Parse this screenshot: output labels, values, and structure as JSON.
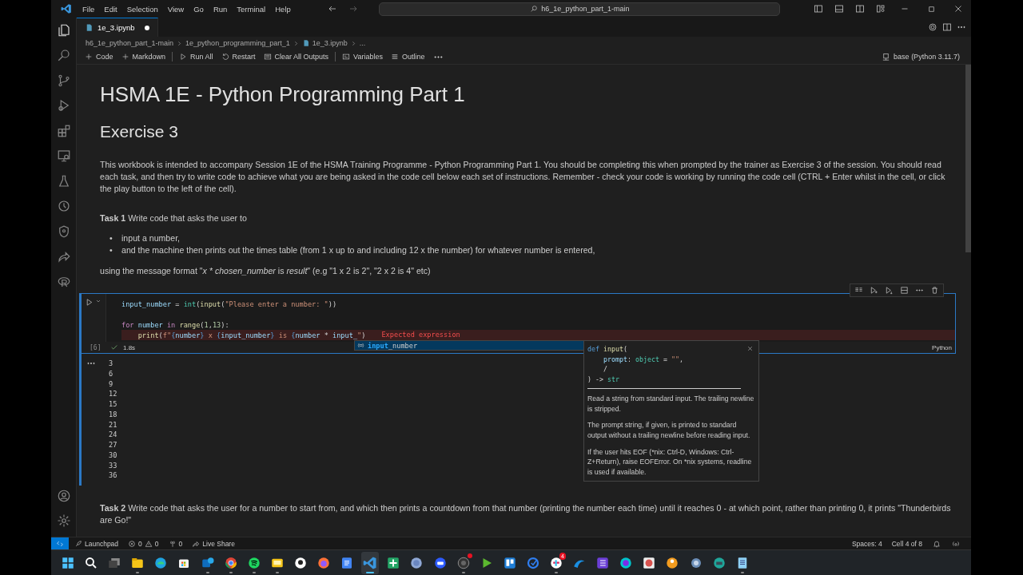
{
  "titlebar": {
    "menu": [
      "File",
      "Edit",
      "Selection",
      "View",
      "Go",
      "Run",
      "Terminal",
      "Help"
    ],
    "search": "h6_1e_python_part_1-main"
  },
  "tabs": [
    {
      "label": "1e_3.ipynb",
      "selected": true,
      "modified": true
    }
  ],
  "breadcrumbs": [
    "h6_1e_python_part_1-main",
    "1e_python_programming_part_1",
    "1e_3.ipynb",
    "..."
  ],
  "toolbar": {
    "actions": [
      {
        "kind": "plus",
        "label": "Code"
      },
      {
        "kind": "plus",
        "label": "Markdown"
      },
      {
        "kind": "run",
        "label": "Run All"
      },
      {
        "kind": "restart",
        "label": "Restart"
      },
      {
        "kind": "clear",
        "label": "Clear All Outputs"
      },
      {
        "kind": "variables",
        "label": "Variables"
      },
      {
        "kind": "outline",
        "label": "Outline"
      },
      {
        "kind": "more"
      }
    ],
    "kernel": "base (Python 3.11.7)"
  },
  "notebook": {
    "title": "HSMA 1E - Python Programming Part 1",
    "subtitle": "Exercise 3",
    "intro": "This workbook is intended to accompany Session 1E of the HSMA Training Programme - Python Programming Part 1. You should be completing this when prompted by the trainer as Exercise 3 of the session. You should read each task, and then try to write code to achieve what you are being asked in the code cell below each set of instructions. Remember - check your code is working by running the code cell (CTRL + Enter whilst in the cell, or click the play button to the left of the cell).",
    "task1": "**Task 1** Write code that asks the user to",
    "bullets": [
      {
        "marker": "•",
        "text": "input a number,"
      },
      {
        "marker": "•",
        "text": "and the machine then prints out the times table (from 1 x up to and including 12 x the number) for whatever number is entered,"
      }
    ],
    "format": [
      {
        "kind": "plain",
        "text": "using the message format \""
      },
      {
        "kind": "emphasis",
        "text": "x * chosen_number"
      },
      {
        "kind": "plain",
        "text": " is "
      },
      {
        "kind": "emphasis",
        "text": "result"
      },
      {
        "kind": "plain",
        "text": "\" (e.g \"1 x 2 is 2\", \"2 x 2 is 4\" etc)"
      }
    ],
    "cell": {
      "focused": true,
      "lines": [
        {
          "error": false,
          "tokens": [
            {
              "kind": "var",
              "text": "input_number"
            },
            {
              "kind": "op",
              "text": " = "
            },
            {
              "kind": "cls",
              "text": "int"
            },
            {
              "kind": "op",
              "text": "("
            },
            {
              "kind": "fn",
              "text": "input"
            },
            {
              "kind": "op",
              "text": "("
            },
            {
              "kind": "str",
              "text": "\"Please enter a number: \""
            },
            {
              "kind": "op",
              "text": "))"
            }
          ]
        },
        {
          "error": false,
          "gap_before": true,
          "tokens": [
            {
              "kind": "kw",
              "text": "for"
            },
            {
              "kind": "var",
              "text": " number"
            },
            {
              "kind": "kw",
              "text": " in"
            },
            {
              "kind": "fn",
              "text": " range"
            },
            {
              "kind": "op",
              "text": "("
            },
            {
              "kind": "num",
              "text": "1"
            },
            {
              "kind": "op",
              "text": ","
            },
            {
              "kind": "num",
              "text": "13"
            },
            {
              "kind": "op",
              "text": "):"
            }
          ]
        },
        {
          "error": true,
          "message": "Expected expression",
          "tokens": [
            {
              "kind": "fn",
              "text": "    print"
            },
            {
              "kind": "op",
              "text": "("
            },
            {
              "kind": "str",
              "text": "f\""
            },
            {
              "kind": "def",
              "text": "{"
            },
            {
              "kind": "var",
              "text": "number"
            },
            {
              "kind": "def",
              "text": "}"
            },
            {
              "kind": "str",
              "text": " x "
            },
            {
              "kind": "def",
              "text": "{"
            },
            {
              "kind": "var",
              "text": "input_number"
            },
            {
              "kind": "def",
              "text": "}"
            },
            {
              "kind": "str",
              "text": " is "
            },
            {
              "kind": "def",
              "text": "{"
            },
            {
              "kind": "var",
              "text": "number"
            },
            {
              "kind": "op",
              "text": " * "
            },
            {
              "kind": "var",
              "text": "input_"
            },
            {
              "kind": "str",
              "text": "\""
            },
            {
              "kind": "op",
              "text": ")"
            }
          ]
        }
      ],
      "execution_count": "[6]",
      "success": true,
      "duration": "1.8s",
      "language": "Python",
      "output": [
        "3",
        "6",
        "9",
        "12",
        "15",
        "18",
        "21",
        "24",
        "27",
        "30",
        "33",
        "36"
      ],
      "suggestion": {
        "match": "input",
        "rest": "_number",
        "selected": true
      },
      "hover": {
        "signature": [
          [
            {
              "kind": "def",
              "text": "def"
            },
            {
              "kind": "fn",
              "text": " input"
            },
            {
              "kind": "op",
              "text": "("
            }
          ],
          [
            {
              "kind": "param",
              "text": "    prompt"
            },
            {
              "kind": "op",
              "text": ": "
            },
            {
              "kind": "cls",
              "text": "object"
            },
            {
              "kind": "op",
              "text": " = "
            },
            {
              "kind": "str",
              "text": "\"\""
            },
            {
              "kind": "op",
              "text": ","
            }
          ],
          [
            {
              "kind": "op",
              "text": "    /"
            }
          ],
          [
            {
              "kind": "op",
              "text": ") -> "
            },
            {
              "kind": "cls",
              "text": "str"
            }
          ]
        ],
        "paragraphs": [
          "Read a string from standard input. The trailing newline is stripped.",
          "The prompt string, if given, is printed to standard output without a trailing newline before reading input.",
          "If the user hits EOF (*nix: Ctrl-D, Windows: Ctrl-Z+Return), raise EOFError. On *nix systems, readline is used if available."
        ]
      }
    },
    "task2": "**Task 2** Write code that asks the user for a number to start from, and which then prints a countdown from that number (printing the number each time) until it reaches 0 - at which point, rather than printing 0, it prints \"Thunderbirds are Go!\""
  },
  "status_bar": {
    "left": [
      {
        "kind": "launchpad",
        "label": "Launchpad"
      },
      {
        "kind": "problems",
        "errors": "0",
        "warnings": "0"
      },
      {
        "kind": "ports",
        "label": "0"
      },
      {
        "kind": "liveshare",
        "label": "Live Share"
      }
    ],
    "right": [
      {
        "kind": "text",
        "label": "Spaces: 4"
      },
      {
        "kind": "text",
        "label": "Cell 4 of 8"
      },
      {
        "kind": "bell"
      },
      {
        "kind": "copilot"
      }
    ]
  },
  "taskbar": {
    "apps": [
      {
        "running": false,
        "active": false
      },
      {
        "running": false,
        "active": false
      },
      {
        "running": false,
        "active": false
      },
      {
        "running": true,
        "active": false
      },
      {
        "running": false,
        "active": false
      },
      {
        "running": false,
        "active": false
      },
      {
        "running": true,
        "active": false
      },
      {
        "running": true,
        "active": false
      },
      {
        "running": true,
        "active": false
      },
      {
        "running": true,
        "active": false
      },
      {
        "running": false,
        "active": false
      },
      {
        "running": false,
        "active": false
      },
      {
        "running": false,
        "active": false
      },
      {
        "running": true,
        "active": true
      },
      {
        "running": false,
        "active": false
      },
      {
        "running": false,
        "active": false
      },
      {
        "running": false,
        "active": false
      },
      {
        "running": true,
        "active": false,
        "dot": true
      },
      {
        "running": false,
        "active": false
      },
      {
        "running": false,
        "active": false
      },
      {
        "running": false,
        "active": false
      },
      {
        "running": true,
        "active": false,
        "badge": "4"
      },
      {
        "running": false,
        "active": false
      },
      {
        "running": false,
        "active": false
      },
      {
        "running": false,
        "active": false
      },
      {
        "running": false,
        "active": false
      },
      {
        "running": false,
        "active": false
      },
      {
        "running": false,
        "active": false
      },
      {
        "running": false,
        "active": false
      },
      {
        "running": true,
        "active": false
      }
    ]
  }
}
